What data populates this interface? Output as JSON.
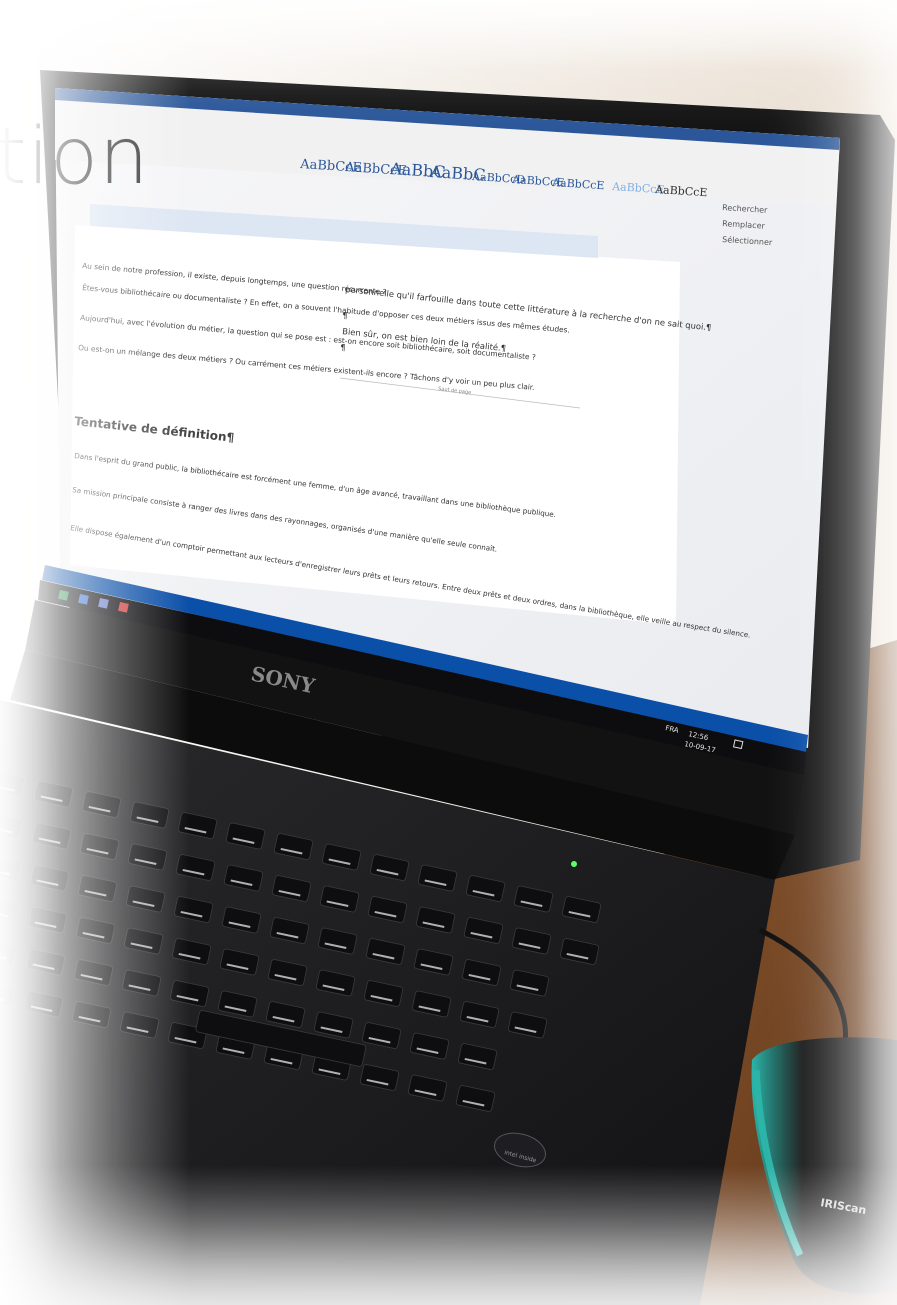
{
  "slide": {
    "heading_fragment": "tion"
  },
  "document": {
    "ribbon_styles": [
      "AaBbCcE",
      "AaBbCcE",
      "AaBbC",
      "AaBbC",
      "AaBbCcD",
      "AaBbCcE",
      "AaBbCcE",
      "AaBbCcE",
      "AaBbCcE"
    ],
    "side_panel": [
      "Rechercher",
      "Remplacer",
      "Sélectionner"
    ],
    "column_left": [
      "Au sein de notre profession, il existe, depuis longtemps, une question récurrente ?",
      "Êtes-vous bibliothécaire ou documentaliste ? En effet, on a souvent l'habitude d'opposer ces deux métiers issus des mêmes études.",
      "Aujourd'hui, avec l'évolution du métier, la question qui se pose est : est-on encore soit bibliothécaire, soit documentaliste ?",
      "Ou est-on un mélange des deux métiers ? Ou carrément ces métiers existent-ils encore ? Tâchons d'y voir un peu plus clair."
    ],
    "section_heading": "Tentative de définition¶",
    "column_left_2": [
      "Dans l'esprit du grand public, la bibliothécaire est forcément une femme, d'un âge avancé, travaillant dans une bibliothèque publique.",
      "Sa mission principale consiste à ranger des livres dans des rayonnages, organisés d'une manière qu'elle seule connaît.",
      "Elle dispose également d'un comptoir permettant aux lecteurs d'enregistrer leurs prêts et leurs retours. Entre deux prêts et deux ordres, dans la bibliothèque, elle veille au respect du silence."
    ],
    "column_right": [
      "personnelle qu'il farfouille dans toute cette littérature à la recherche d'on ne sait quoi.¶",
      "¶",
      "Bien sûr, on est bien loin de la réalité.¶",
      "¶"
    ],
    "footnote_label": "Saut de page"
  },
  "laptop": {
    "brand": "SONY",
    "tray_time": "12:56",
    "tray_date": "10-09-17",
    "tray_lang": "FRA",
    "sticker": "intel inside"
  },
  "mouse": {
    "brand": "IRIScan"
  },
  "colors": {
    "bezel": "#141414",
    "keyboard": "#1a1a1c",
    "desk": "#7a4a26",
    "taskbar": "#0a4fa8",
    "mouse_accent": "#2bb5a8",
    "screen": "#f3f4f7"
  }
}
